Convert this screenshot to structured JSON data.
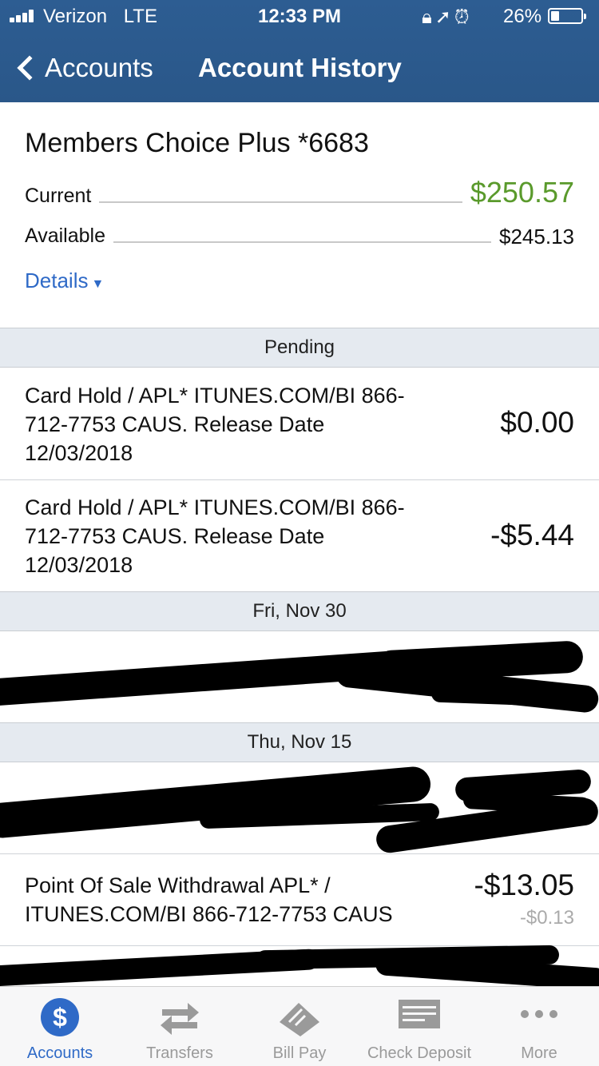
{
  "status_bar": {
    "carrier": "Verizon",
    "network": "LTE",
    "time": "12:33 PM",
    "icons": [
      "orientation-lock-icon",
      "location-icon",
      "alarm-icon"
    ],
    "battery_percent": "26%"
  },
  "nav": {
    "back_label": "Accounts",
    "title": "Account History"
  },
  "account": {
    "name": "Members Choice Plus *6683",
    "current_label": "Current",
    "current_value": "$250.57",
    "available_label": "Available",
    "available_value": "$245.13",
    "details_label": "Details"
  },
  "sections": {
    "pending": "Pending",
    "nov30": "Fri, Nov 30",
    "nov15": "Thu, Nov 15"
  },
  "transactions": [
    {
      "description": "Card Hold / APL* ITUNES.COM/BI 866-712-7753 CAUS. Release Date 12/03/2018",
      "amount": "$0.00"
    },
    {
      "description": "Card Hold / APL* ITUNES.COM/BI 866-712-7753 CAUS. Release Date 12/03/2018",
      "amount": "-$5.44"
    },
    {
      "description": "Point Of Sale Withdrawal APL* / ITUNES.COM/BI 866-712-7753 CAUS",
      "amount": "-$13.05",
      "running_balance": "-$0.13"
    }
  ],
  "tabs": [
    {
      "label": "Accounts",
      "icon": "dollar-icon",
      "active": true
    },
    {
      "label": "Transfers",
      "icon": "transfer-arrows-icon",
      "active": false
    },
    {
      "label": "Bill Pay",
      "icon": "bill-pay-icon",
      "active": false
    },
    {
      "label": "Check Deposit",
      "icon": "check-deposit-icon",
      "active": false
    },
    {
      "label": "More",
      "icon": "more-dots-icon",
      "active": false
    }
  ],
  "colors": {
    "nav_bar": "#2a5789",
    "accent_blue": "#2f6ac7",
    "positive_green": "#5a9a2c",
    "section_bg": "#e5eaf0"
  }
}
